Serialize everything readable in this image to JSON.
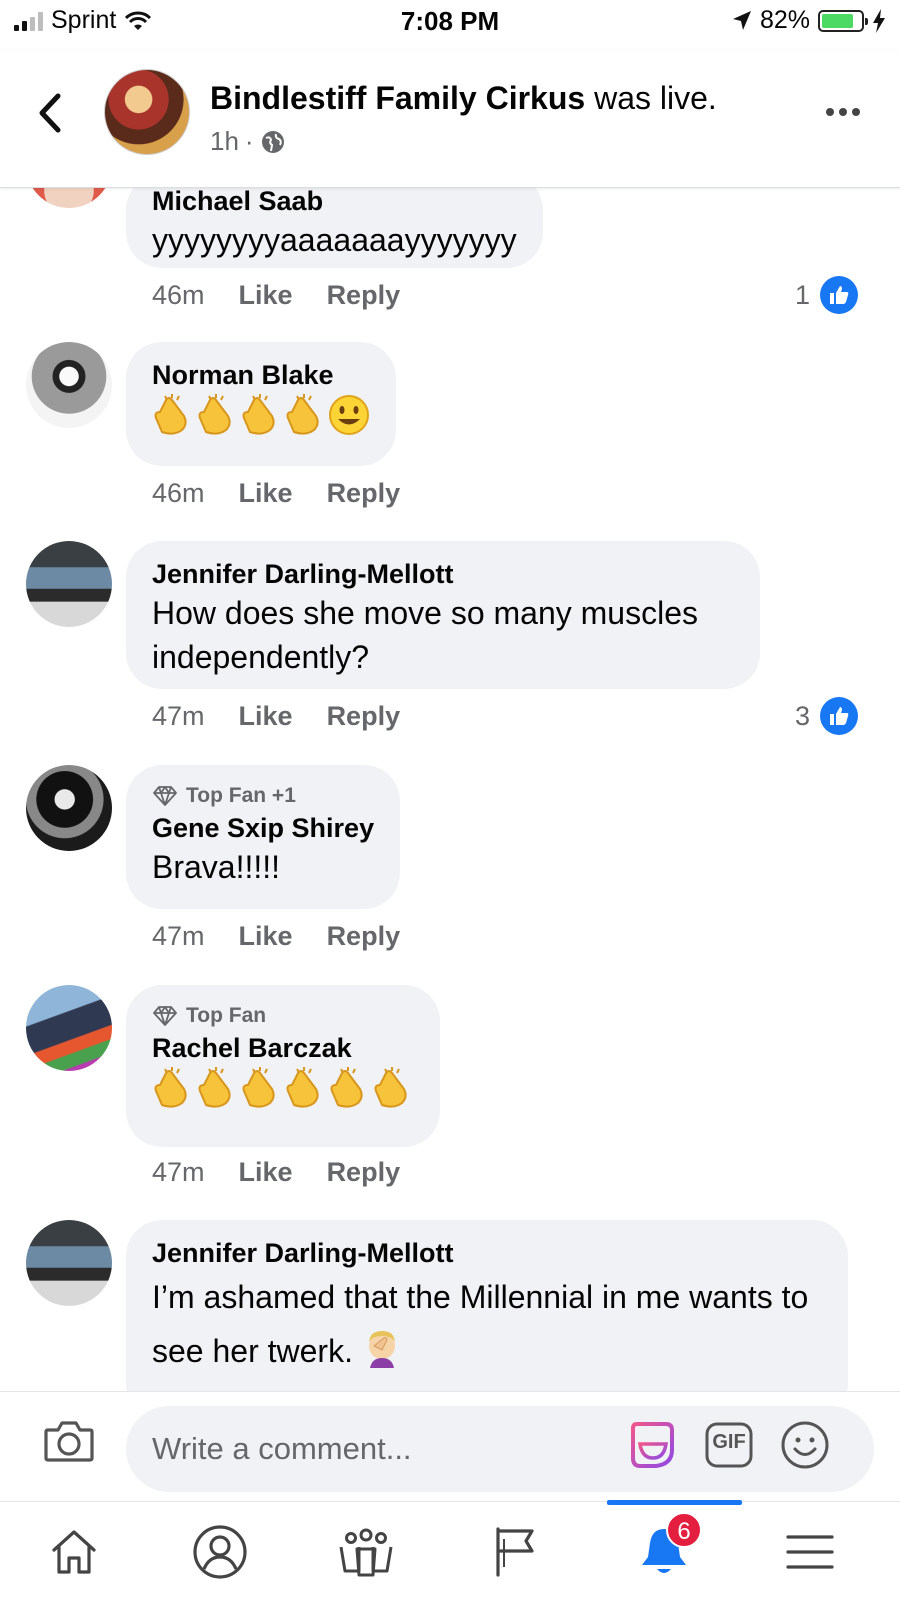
{
  "status_bar": {
    "carrier": "Sprint",
    "time": "7:08 PM",
    "battery_percent": "82%",
    "battery_level": 0.82
  },
  "header": {
    "page_name": "Bindlestiff Family Cirkus",
    "action_text": " was live.",
    "time_ago": "1h",
    "separator": "·"
  },
  "comments": [
    {
      "name": "Michael Saab",
      "text": "yyyyyyyyaaaaaaayyyyyyy",
      "time": "46m",
      "like_label": "Like",
      "reply_label": "Reply",
      "reaction_count": "1"
    },
    {
      "name": "Norman Blake",
      "emojis": [
        "clapping-hands",
        "clapping-hands",
        "clapping-hands",
        "clapping-hands",
        "smiling-face"
      ],
      "time": "46m",
      "like_label": "Like",
      "reply_label": "Reply"
    },
    {
      "name": "Jennifer Darling-Mellott",
      "text": "How does she move so many muscles independently?",
      "time": "47m",
      "like_label": "Like",
      "reply_label": "Reply",
      "reaction_count": "3"
    },
    {
      "badge": "Top Fan +1",
      "name": "Gene Sxip Shirey",
      "text": "Brava!!!!!",
      "time": "47m",
      "like_label": "Like",
      "reply_label": "Reply"
    },
    {
      "badge": "Top Fan",
      "name": "Rachel Barczak",
      "emojis": [
        "clapping-hands",
        "clapping-hands",
        "clapping-hands",
        "clapping-hands",
        "clapping-hands",
        "clapping-hands"
      ],
      "time": "47m",
      "like_label": "Like",
      "reply_label": "Reply"
    },
    {
      "name": "Jennifer Darling-Mellott",
      "text": "I’m ashamed that the Millennial in me wants to see her twerk.",
      "trailing_emoji": "face-palm"
    }
  ],
  "composer": {
    "placeholder": "Write a comment...",
    "gif_label": "GIF"
  },
  "tab_bar": {
    "tabs": [
      "home-icon",
      "profile-icon",
      "groups-icon",
      "pages-icon",
      "notifications-icon",
      "menu-icon"
    ],
    "active": "notifications-icon",
    "notification_count": "6"
  },
  "colors": {
    "accent": "#1877f2",
    "bubble": "#f0f2f5",
    "secondary_text": "#65676b",
    "badge_red": "#e41e3f",
    "battery_green": "#4cd964"
  }
}
